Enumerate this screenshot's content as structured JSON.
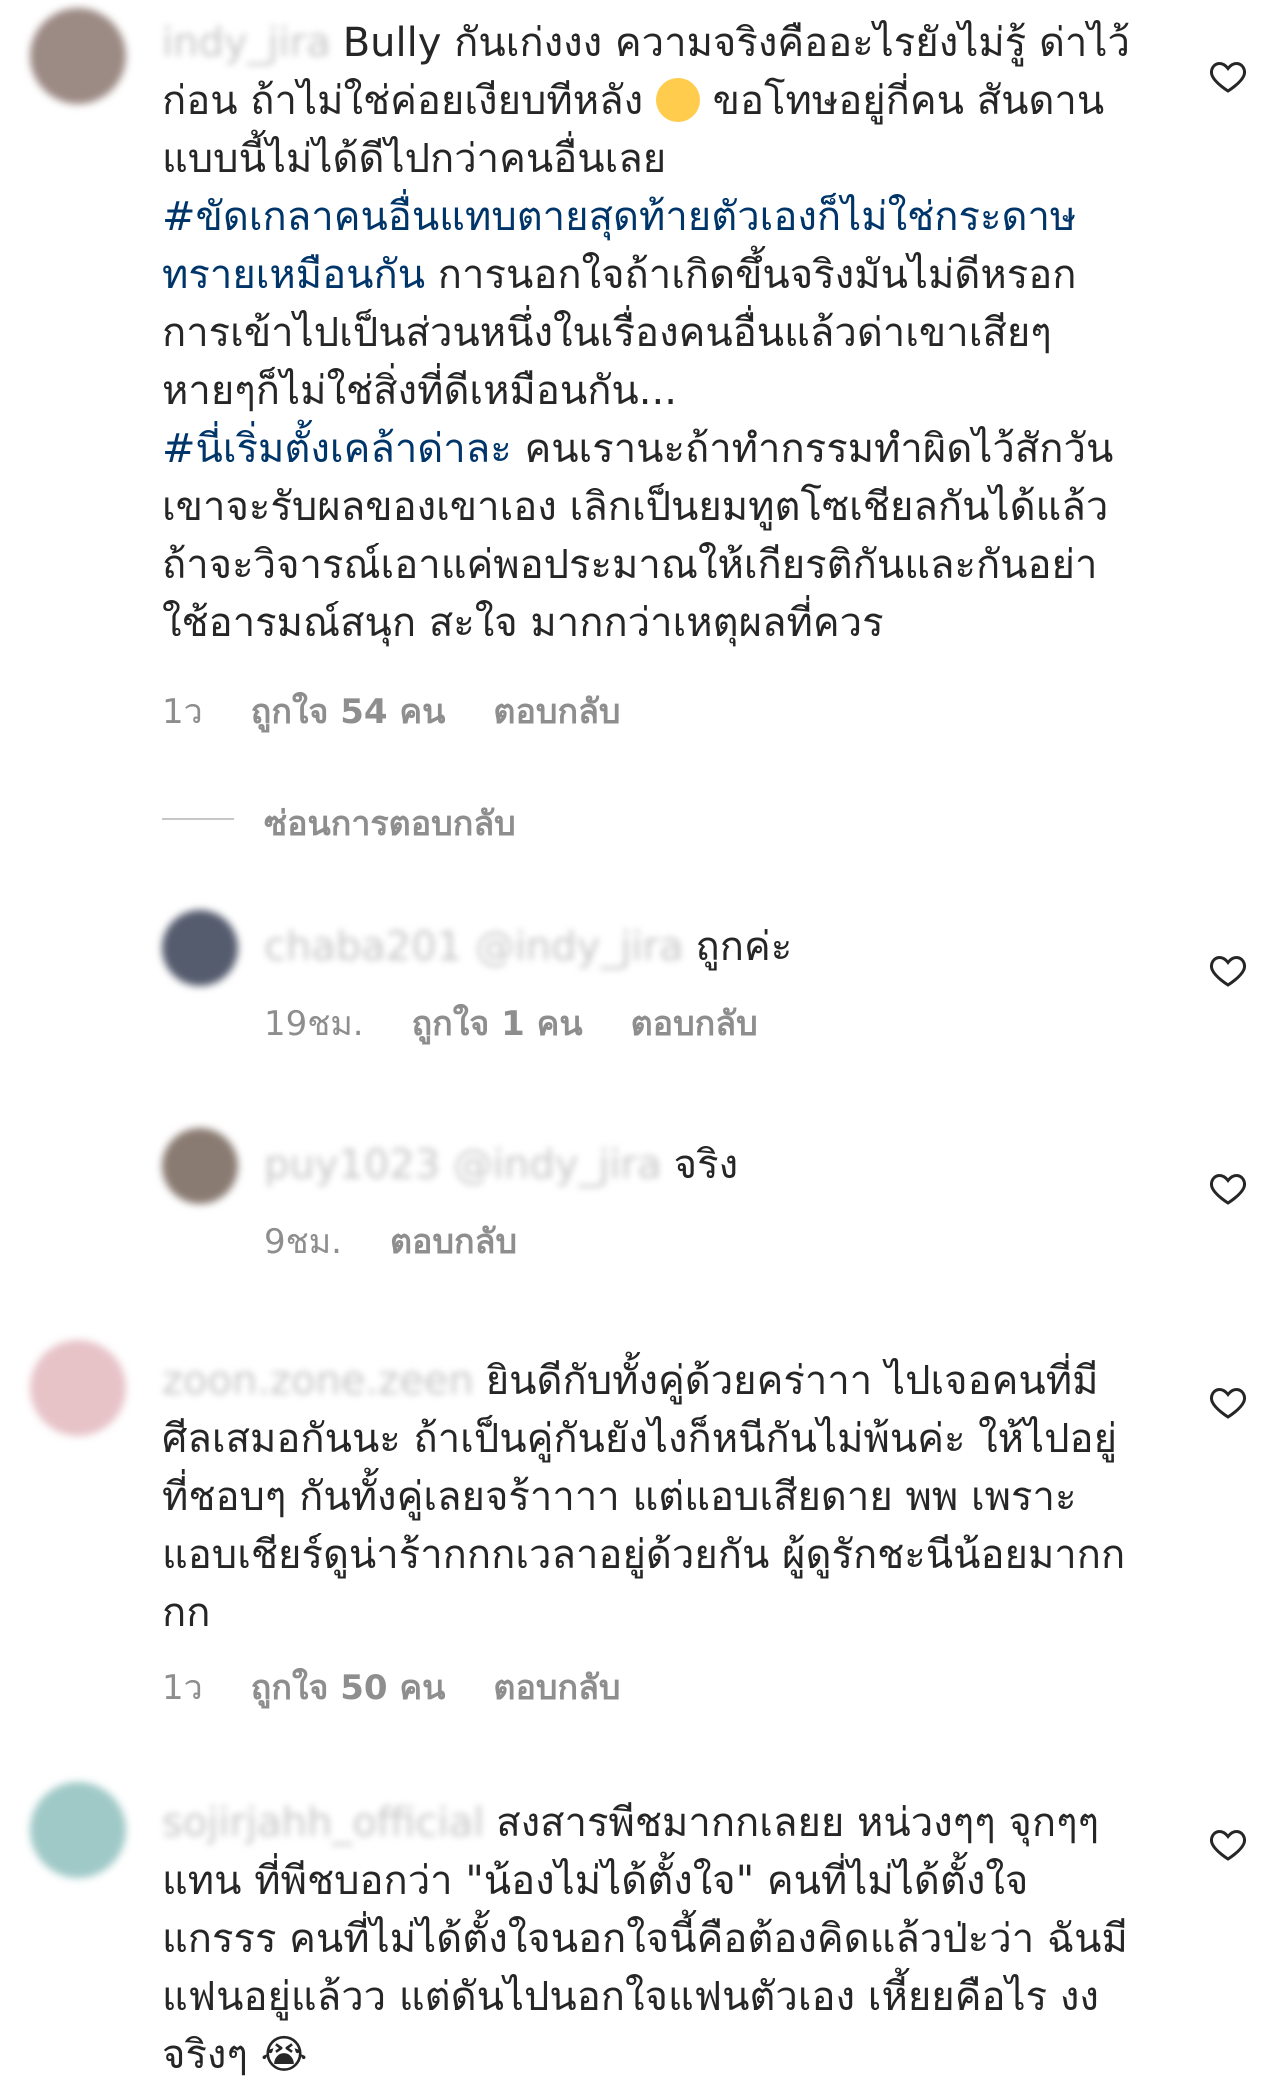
{
  "comments": [
    {
      "username": "indy_jira",
      "text_parts": [
        {
          "t": "Bully กันเก่งงง ความจริงคืออะไรยังไม่รู้ ",
          "type": "text"
        },
        {
          "t": "ด่าไว้ก่อน ถ้าไม่ใช่ค่อยเงียบทีหลัง ",
          "type": "text"
        },
        {
          "t": "🤐",
          "type": "emoji"
        },
        {
          "t": " ขอโทษอยู่กี่คน สันดานแบบนี้ไม่ได้ดีไปกว่าคนอื่นเลย",
          "type": "text"
        },
        {
          "t": "#ขัดเกลาคนอื่นแทบตายสุดท้ายตัวเองก็ไม่ใช่กระดาษทรายเหมือนกัน",
          "type": "hashtag"
        },
        {
          "t": " การนอกใจถ้าเกิดขึ้นจริงมันไม่ดีหรอก การเข้าไปเป็นส่วนหนึ่งในเรื่องคนอื่นแล้วด่าเขาเสียๆหายๆก็ไม่ใช่สิ่งที่ดีเหมือนกัน...",
          "type": "text"
        },
        {
          "t": "#นี่เริ่มตั้งเคล้าด่าละ",
          "type": "hashtag"
        },
        {
          "t": " คนเรานะถ้าทำกรรมทำผิดไว้สักวันเขาจะรับผลของเขาเอง เลิกเป็นยมทูตโซเชียลกันได้แล้ว ถ้าจะวิจารณ์เอาแค่พอประมาณให้เกียรติกันและกันอย่าใช้อารมณ์สนุก สะใจ มากกว่าเหตุผลที่ควร",
          "type": "text"
        }
      ],
      "time": "1ว",
      "likes": "ถูกใจ 54 คน",
      "reply": "ตอบกลับ"
    },
    {
      "username": "chaba201 @indy_jira",
      "text": "ถูกค่ะ",
      "time": "19ชม.",
      "likes": "ถูกใจ 1 คน",
      "reply": "ตอบกลับ"
    },
    {
      "username": "puy1023 @indy_jira",
      "text": "จริง",
      "time": "9ชม.",
      "reply": "ตอบกลับ"
    },
    {
      "username": "zoon.zone.zeen",
      "text": "ยินดีกับทั้งคู่ด้วยคร่าาา ไปเจอคนที่มีศีลเสมอกันนะ  ถ้าเป็นคู่กันยังไงก็หนีกันไม่พ้นค่ะ ให้ไปอยู่ที่ชอบๆ กันทั้งคู่เลยจร้าาาา  แต่แอบเสียดาย พพ เพราะแอบเชียร์ดูน่าร้ากกกเวลาอยู่ด้วยกัน ผู้ดูรักชะนีน้อยมากกกก",
      "time": "1ว",
      "likes": "ถูกใจ 50 คน",
      "reply": "ตอบกลับ"
    },
    {
      "username": "sojirjahh_official",
      "text": "สงสารพีชมากกเลยย หน่วงๆๆ จุกๆๆแทน ที่พีชบอกว่า \"น้องไม่ได้ตั้งใจ\" คนที่ไม่ได้ตั้งใจแกรรร คนที่ไม่ได้ตั้งใจนอกใจนี้คือต้องคิดแล้วป่ะว่า ฉันมีแฟนอยู่แล้วว แต่ดันไปนอกใจแฟนตัวเอง เหี้ยยคือไร งง จริงๆ",
      "emoji": "😭"
    }
  ],
  "hide_replies": "ซ่อนการตอบกลับ",
  "colors": {
    "hashtag": "#003569",
    "meta": "#8e8e8e"
  }
}
